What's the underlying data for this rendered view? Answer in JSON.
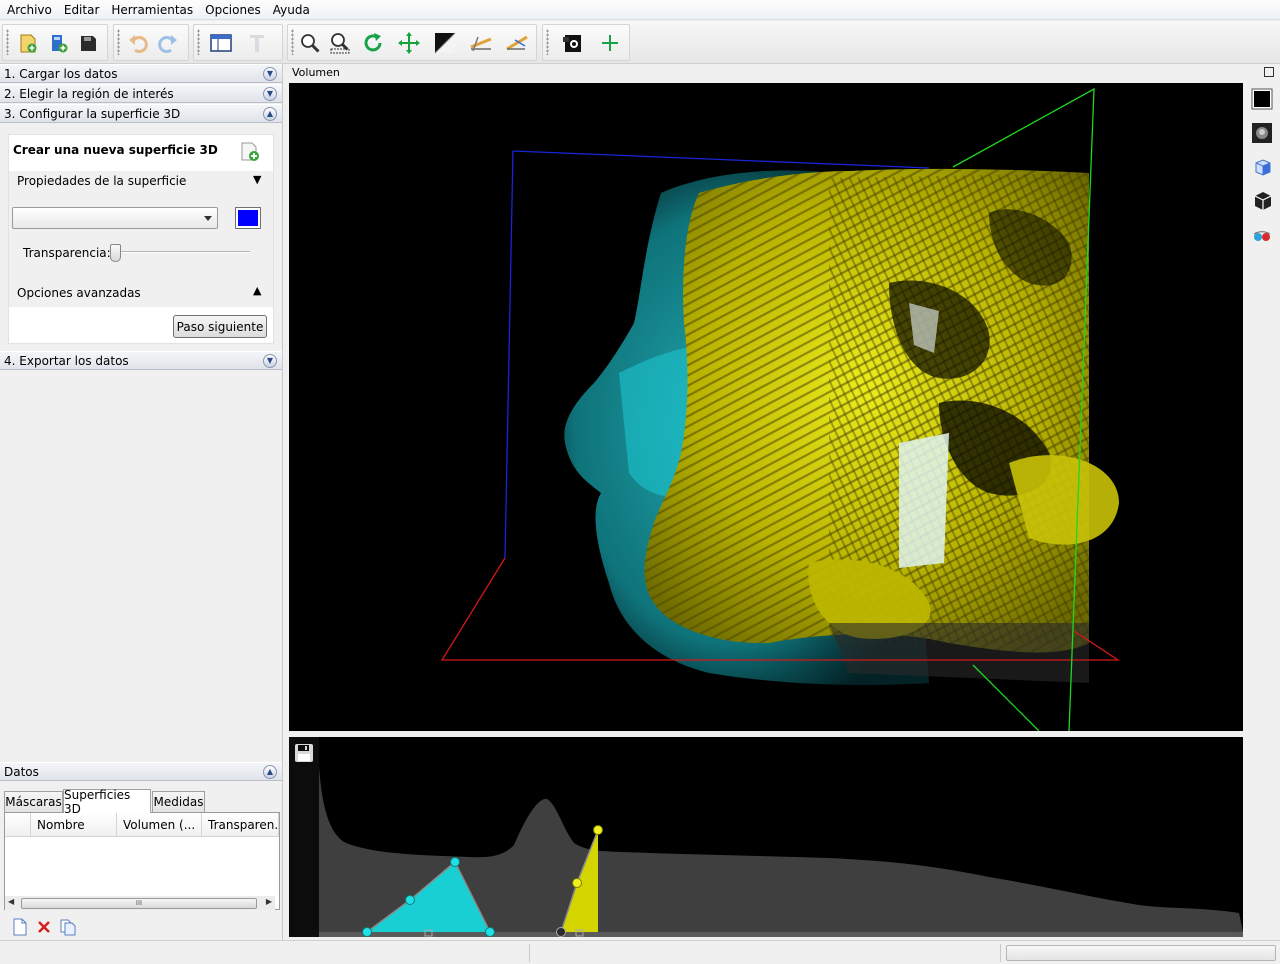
{
  "menubar": {
    "items": [
      {
        "label": "Archivo"
      },
      {
        "label": "Editar"
      },
      {
        "label": "Herramientas"
      },
      {
        "label": "Opciones"
      },
      {
        "label": "Ayuda"
      }
    ]
  },
  "toolbar": {
    "icons": [
      "import-icon",
      "open-project-icon",
      "close-project-icon",
      "undo-icon",
      "redo-icon",
      "layout-icon",
      "text-icon",
      "zoom-icon",
      "zoom-region-icon",
      "rotate-icon",
      "pan-icon",
      "contrast-icon",
      "measure-linear-icon",
      "measure-angular-icon",
      "screenshot-icon",
      "add-icon"
    ]
  },
  "left_panel": {
    "sections": [
      {
        "title": "1. Cargar los datos",
        "expanded": false
      },
      {
        "title": "2. Elegir la región de interés",
        "expanded": false
      },
      {
        "title": "3. Configurar la superficie 3D",
        "expanded": true
      },
      {
        "title": "4. Exportar los datos",
        "expanded": false
      }
    ],
    "config": {
      "heading": "Crear una nueva superficie 3D",
      "properties_label": "Propiedades de la superficie",
      "properties_arrow": "▼",
      "surface_select_value": "",
      "color": "#0000ff",
      "transparency_label": "Transparencia:",
      "transparency_value": 0,
      "advanced_label": "Opciones avanzadas",
      "advanced_arrow": "▲",
      "next_button": "Paso siguiente"
    },
    "datos": {
      "title": "Datos",
      "tabs": [
        {
          "label": "Máscaras",
          "active": false
        },
        {
          "label": "Superficies 3D",
          "active": true
        },
        {
          "label": "Medidas",
          "active": false
        }
      ],
      "columns": [
        "Nombre",
        "Volumen (...",
        "Transparen..."
      ],
      "rows": [],
      "scroll_label": "III",
      "actions": [
        "new-surface-icon",
        "delete-icon",
        "duplicate-icon"
      ]
    }
  },
  "volume_panel": {
    "title": "Volumen"
  },
  "colors": {
    "accent_blue": "#0000ff",
    "skin_cyan": "#1ecfd6",
    "bone_yellow": "#d8d800",
    "viewport_bg": "#000000"
  }
}
